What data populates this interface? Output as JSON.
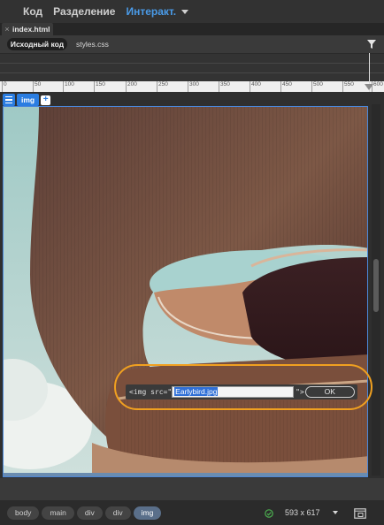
{
  "view_switcher": {
    "code": "Код",
    "split": "Разделение",
    "live": "Интеракт."
  },
  "document": {
    "tab_label": "index.html",
    "close_glyph": "×"
  },
  "related_files": {
    "source": "Исходный код",
    "css": "styles.css"
  },
  "ruler": {
    "ticks": [
      "0",
      "50",
      "100",
      "150",
      "200",
      "250",
      "300",
      "350",
      "400",
      "450",
      "500",
      "550",
      "600"
    ]
  },
  "element_hud": {
    "tag": "img",
    "add": "+"
  },
  "quick_tag_editor": {
    "prefix": "<img src=\"",
    "value": "Earlybird.jpg",
    "suffix": "\">",
    "ok": "OK"
  },
  "status_bar": {
    "breadcrumbs": [
      "body",
      "main",
      "div",
      "div",
      "img"
    ],
    "selected_crumb": "img",
    "window_size": "593 x 617"
  },
  "colors": {
    "accent": "#2a7de1",
    "highlight_ring": "#f0a020",
    "active_view": "#4a9be8"
  }
}
